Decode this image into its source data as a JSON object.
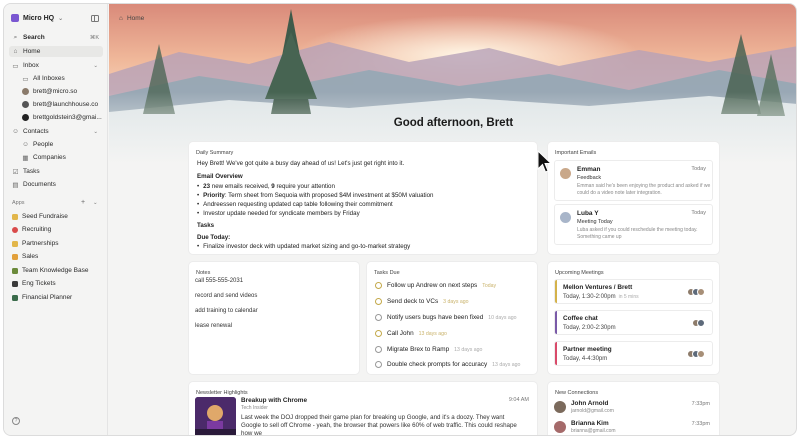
{
  "sidebar": {
    "workspace": "Micro HQ",
    "search": {
      "label": "Search",
      "shortcut": "⌘K"
    },
    "home": "Home",
    "inbox": {
      "label": "Inbox",
      "items": [
        "All Inboxes",
        "brett@micro.so",
        "brett@launchhouse.co",
        "brettgoldstein3@gmai..."
      ]
    },
    "contacts": {
      "label": "Contacts",
      "items": [
        "People",
        "Companies"
      ]
    },
    "tasks": "Tasks",
    "documents": "Documents",
    "apps_label": "Apps",
    "apps": [
      {
        "label": "Seed Fundraise",
        "color": "#e2b64a"
      },
      {
        "label": "Recruiting",
        "color": "#d94a4a"
      },
      {
        "label": "Partnerships",
        "color": "#e2b64a"
      },
      {
        "label": "Sales",
        "color": "#e2a03a"
      },
      {
        "label": "Team Knowledge Base",
        "color": "#6b8a3a"
      },
      {
        "label": "Eng Tickets",
        "color": "#3a3a3a"
      },
      {
        "label": "Financial Planner",
        "color": "#3a6b4a"
      }
    ],
    "help": "?"
  },
  "header": {
    "breadcrumb": "Home",
    "greeting": "Good afternoon, Brett"
  },
  "daily_summary": {
    "title": "Daily Summary",
    "intro": "Hey Brett! We've got quite a busy day ahead of us! Let's just get right into it.",
    "email_overview_heading": "Email Overview",
    "email_new_count": "23",
    "email_new_text": " new emails received, ",
    "email_reply_count": "9",
    "email_reply_text": " require your attention",
    "priority_label": "Priority",
    "priority_text": ": Term sheet from Sequoia with proposed $4M investment at $50M valuation",
    "bullet_3": "Andreessen requesting updated cap table following their commitment",
    "bullet_4": "Investor update needed for syndicate members by Friday",
    "tasks_heading": "Tasks",
    "due_today": "Due Today:",
    "task_1": "Finalize investor deck with updated market sizing and go-to-market strategy"
  },
  "important_emails": {
    "title": "Important Emails",
    "items": [
      {
        "name": "Emman",
        "subject": "Feedback",
        "preview": "Emman said he's been enjoying the product and asked if we could do a video note later integration.",
        "time": "Today"
      },
      {
        "name": "Luba Y",
        "subject": "Meeting Today",
        "preview": "Luba asked if you could reschedule the meeting today. Something came up",
        "time": "Today"
      }
    ]
  },
  "notes": {
    "title": "Notes",
    "items": [
      "call 555-555-2031",
      "record and send videos",
      "add training to calendar",
      "lease renewal"
    ]
  },
  "tasks_due": {
    "title": "Tasks Due",
    "items": [
      {
        "label": "Follow up Andrew on next steps",
        "date": "Today",
        "color": "#c4a94a"
      },
      {
        "label": "Send deck to VCs",
        "date": "3 days ago",
        "color": "#c4a94a"
      },
      {
        "label": "Notify users bugs have been fixed",
        "date": "10 days ago",
        "color": "#999999"
      },
      {
        "label": "Call John",
        "date": "13 days ago",
        "color": "#c4a94a"
      },
      {
        "label": "Migrate Brex to Ramp",
        "date": "13 days ago",
        "color": "#999999"
      },
      {
        "label": "Double check prompts for accuracy",
        "date": "13 days ago",
        "color": "#999999"
      }
    ]
  },
  "meetings": {
    "title": "Upcoming Meetings",
    "items": [
      {
        "name": "Mellon Ventures / Brett",
        "time": "Today, 1:30-2:00pm",
        "rel": "in 5 mins",
        "color": "#d4b24a"
      },
      {
        "name": "Coffee chat",
        "time": "Today, 2:00-2:30pm",
        "rel": "",
        "color": "#7a5aa8"
      },
      {
        "name": "Partner meeting",
        "time": "Today, 4-4:30pm",
        "rel": "",
        "color": "#d94a6a"
      }
    ]
  },
  "newsletter": {
    "title": "Newsletter Highlights",
    "item_title": "Breakup with Chrome",
    "source": "Tech Insider",
    "time": "9:04 AM",
    "body": "Last week the DOJ dropped their game plan for breaking up Google, and it's a doozy. They want Google to sell off Chrome - yeah, the browser that powers like 60% of web traffic. This could reshape how we"
  },
  "connections": {
    "title": "New Connections",
    "items": [
      {
        "name": "John Arnold",
        "email": "jarnold@gmail.com",
        "time": "7:33pm"
      },
      {
        "name": "Brianna Kim",
        "email": "brianna@gmail.com",
        "time": "7:33pm"
      }
    ]
  }
}
